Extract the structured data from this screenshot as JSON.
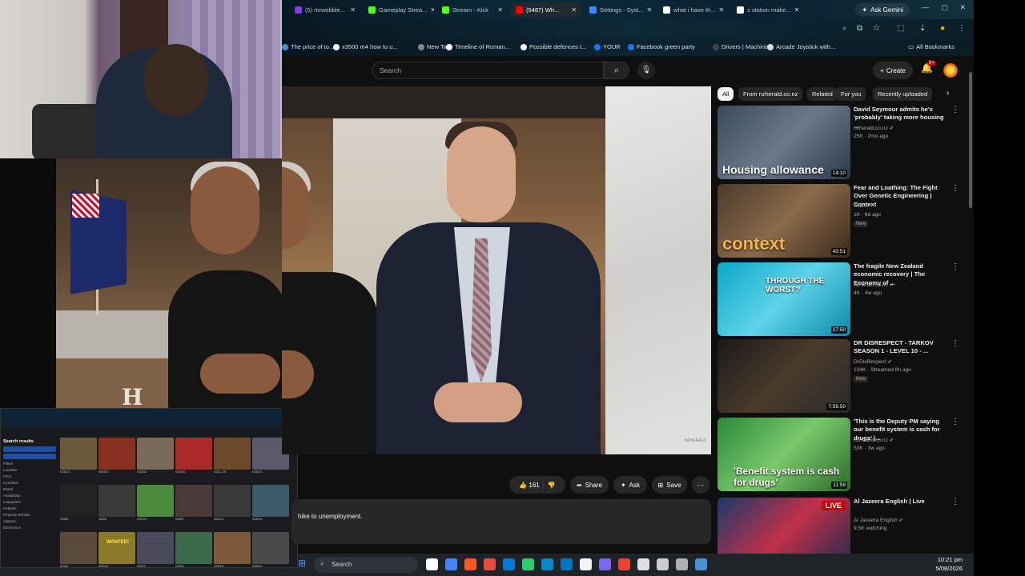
{
  "browser": {
    "tabs": [
      {
        "label": "(5) mrwobble...",
        "color": "#7b3fe4"
      },
      {
        "label": "Gameplay Strea...",
        "color": "#53fc18"
      },
      {
        "label": "Stream - Kick",
        "color": "#53fc18"
      },
      {
        "label": "(5487) Wh...",
        "color": "#ff0000",
        "active": true
      },
      {
        "label": "Settings - Syst...",
        "color": "#4285f4"
      },
      {
        "label": "what i have th...",
        "color": "#ffffff"
      },
      {
        "label": "z station make...",
        "color": "#ffffff"
      }
    ],
    "gemini_label": "Ask Gemini",
    "bookmarks": [
      {
        "label": "The price of to...",
        "color": "#4a90d9"
      },
      {
        "label": "x3500 m4 how to u...",
        "color": "#ffffff"
      },
      {
        "label": "New Tab",
        "color": "#888888"
      },
      {
        "label": "Timeline of Roman...",
        "color": "#ffffff"
      },
      {
        "label": "Possible defences t...",
        "color": "#ffffff"
      },
      {
        "label": "YOUR",
        "color": "#1877f2"
      },
      {
        "label": "Facebook green party",
        "color": "#1877f2"
      },
      {
        "label": "Drivers | Machinist",
        "color": "#444444"
      },
      {
        "label": "Arcade Joystick with...",
        "color": "#dddddd"
      }
    ],
    "all_bookmarks_label": "All Bookmarks"
  },
  "youtube": {
    "search_placeholder": "Search",
    "create_label": "Create",
    "notif_count": "9+",
    "actions": {
      "likes": "161",
      "share": "Share",
      "ask": "Ask",
      "save": "Save"
    },
    "description_snippet": "hike to unemployment.",
    "video_watermark": "NZHERALD",
    "chips": [
      "All",
      "From nzherald.co.nz",
      "Related",
      "For you",
      "Recently uploaded"
    ],
    "recommendations": [
      {
        "title": "David Seymour admits he's 'probably' taking more housing ...",
        "channel": "nzherald.co.nz",
        "verified": true,
        "meta": "25K · 2mo ago",
        "duration": "14:10",
        "thumb_text": "Housing allowance",
        "badge": ""
      },
      {
        "title": "Fear and Loathing: The Fight Over Genetic Engineering | Context",
        "channel": "RNZ",
        "verified": false,
        "meta": "1K · 6d ago",
        "duration": "43:51",
        "thumb_text": "context",
        "badge": "New"
      },
      {
        "title": "The fragile New Zealand economic recovery | The Economy of ...",
        "channel": "nzherald.co.nz",
        "verified": true,
        "meta": "4K · 4w ago",
        "duration": "27:50",
        "thumb_text": "THROUGH THE WORST?",
        "badge": ""
      },
      {
        "title": "DR DISRESPECT - TARKOV SEASON 1 - LEVEL 10 - ...",
        "channel": "DrDisRespect",
        "verified": true,
        "meta": "134K · Streamed 8h ago",
        "duration": "7:56:50",
        "thumb_text": "",
        "badge": "New"
      },
      {
        "title": "'This is the Deputy PM saying our benefit system is cash for drugs' |...",
        "channel": "nzherald.co.nz",
        "verified": true,
        "meta": "53K · 3w ago",
        "duration": "11:59",
        "thumb_text": "'Benefit system is cash for drugs'",
        "badge": ""
      },
      {
        "title": "Al Jazeera English | Live",
        "channel": "Al Jazeera English",
        "verified": true,
        "meta": "9.5K watching",
        "duration": "",
        "thumb_text": "",
        "badge": "",
        "live": "LIVE"
      }
    ]
  },
  "mini_screen": {
    "sidebar_title": "Search results",
    "sidebar_rows": [
      "Filters",
      "Location",
      "Price",
      "Condition",
      "Brand",
      "Availability",
      "Categories",
      "Hobbies",
      "Property Rentals",
      "Apparel",
      "Electronics"
    ],
    "wanted_label": "WANTED!",
    "listings": [
      {
        "price": "NZ$220",
        "color": "#6a5a3a"
      },
      {
        "price": "NZ$180",
        "color": "#8a3020"
      },
      {
        "price": "NZ$250",
        "color": "#7a6a5a"
      },
      {
        "price": "NZ$200",
        "color": "#aa2a2a"
      },
      {
        "price": "NZ$1,200",
        "color": "#6a4a2a"
      },
      {
        "price": "NZ$150",
        "color": "#5a5a6a"
      },
      {
        "price": "NZ$80",
        "color": "#222222"
      },
      {
        "price": "NZ$90",
        "color": "#3a3a3a"
      },
      {
        "price": "NZ$120",
        "color": "#4a8a3a"
      },
      {
        "price": "NZ$60",
        "color": "#4a3a3a"
      },
      {
        "price": "NZ$100",
        "color": "#3a3a3a"
      },
      {
        "price": "NZ$130",
        "color": "#3a5a6a"
      },
      {
        "price": "NZ$40",
        "color": "#5a4a3a"
      },
      {
        "price": "NZ$250",
        "color": "#8a7a2a"
      },
      {
        "price": "NZ$75",
        "color": "#4a4a5a"
      },
      {
        "price": "NZ$90",
        "color": "#3a6a4a"
      },
      {
        "price": "NZ$300",
        "color": "#7a5a3a"
      },
      {
        "price": "NZ$150",
        "color": "#4a4a4a"
      }
    ]
  },
  "taskbar": {
    "search_placeholder": "Search",
    "time": "10:21 pm",
    "date": "5/08/2026"
  }
}
